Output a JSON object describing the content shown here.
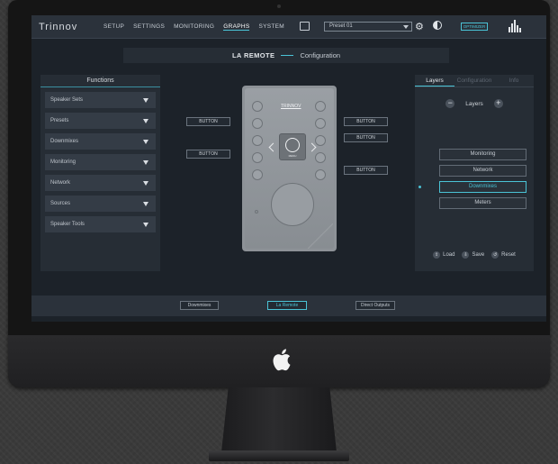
{
  "app": {
    "logo": "Trinnov"
  },
  "topbar": {
    "menu": [
      {
        "label": "SETUP",
        "active": false
      },
      {
        "label": "SETTINGS",
        "active": false
      },
      {
        "label": "MONITORING",
        "active": false
      },
      {
        "label": "GRAPHS",
        "active": true
      },
      {
        "label": "SYSTEM",
        "active": false
      }
    ],
    "preset": "Preset 01",
    "optimizer_label": "OPTIMIZER"
  },
  "header": {
    "title": "LA REMOTE",
    "subtitle": "Configuration"
  },
  "functions": {
    "title": "Functions",
    "items": [
      "Speaker Sets",
      "Presets",
      "Downmixes",
      "Monitoring",
      "Network",
      "Sources",
      "Speaker Tools"
    ]
  },
  "remote": {
    "brand": "TRINNOV",
    "center_label": "MENU"
  },
  "assignments": {
    "left": [
      "BUTTON",
      "BUTTON"
    ],
    "right": [
      "BUTTON",
      "BUTTON",
      "BUTTON"
    ]
  },
  "right_panel": {
    "tabs": [
      {
        "label": "Layers",
        "active": true
      },
      {
        "label": "Configuration",
        "active": false
      },
      {
        "label": "Info",
        "active": false
      }
    ],
    "layers_label": "Layers",
    "layers": [
      {
        "label": "Monitoring",
        "active": false
      },
      {
        "label": "Network",
        "active": false
      },
      {
        "label": "Downmixes",
        "active": true
      },
      {
        "label": "Meters",
        "active": false
      }
    ],
    "actions": {
      "load": "Load",
      "save": "Save",
      "reset": "Reset"
    }
  },
  "bottombar": {
    "buttons": [
      {
        "label": "Downmixes",
        "active": false
      },
      {
        "label": "La Remote",
        "active": true
      },
      {
        "label": "Direct Outputs",
        "active": false
      }
    ]
  },
  "colors": {
    "accent": "#4ac3d6",
    "panel": "#262d35",
    "background": "#1c2229"
  }
}
